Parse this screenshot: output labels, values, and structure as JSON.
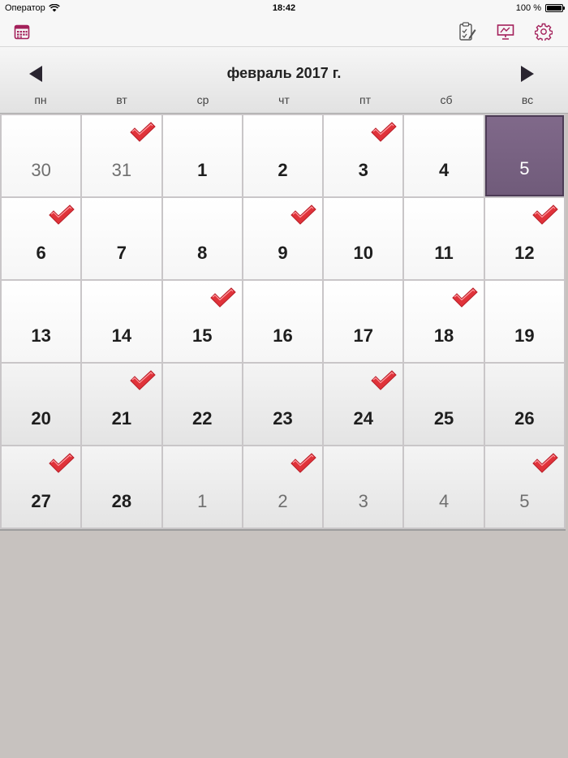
{
  "status_bar": {
    "carrier": "Оператор",
    "time": "18:42",
    "battery": "100 %"
  },
  "header": {
    "month_title": "февраль 2017 г.",
    "prev_label": "◀",
    "next_label": "▶"
  },
  "weekdays": [
    "пн",
    "вт",
    "ср",
    "чт",
    "пт",
    "сб",
    "вс"
  ],
  "toolbar": {
    "left": {
      "icon": "calendar-icon"
    },
    "right": [
      {
        "icon": "clipboard-edit-icon"
      },
      {
        "icon": "presentation-icon"
      },
      {
        "icon": "gear-icon"
      }
    ]
  },
  "colors": {
    "accent": "#a3205a",
    "selected": "#76617f",
    "check": "#e0333a"
  },
  "days": [
    {
      "label": "30",
      "current_month": false,
      "checked": false
    },
    {
      "label": "31",
      "current_month": false,
      "checked": true
    },
    {
      "label": "1",
      "current_month": true,
      "checked": false
    },
    {
      "label": "2",
      "current_month": true,
      "checked": false
    },
    {
      "label": "3",
      "current_month": true,
      "checked": true
    },
    {
      "label": "4",
      "current_month": true,
      "checked": false
    },
    {
      "label": "5",
      "current_month": true,
      "checked": false,
      "selected": true
    },
    {
      "label": "6",
      "current_month": true,
      "checked": true
    },
    {
      "label": "7",
      "current_month": true,
      "checked": false
    },
    {
      "label": "8",
      "current_month": true,
      "checked": false
    },
    {
      "label": "9",
      "current_month": true,
      "checked": true
    },
    {
      "label": "10",
      "current_month": true,
      "checked": false
    },
    {
      "label": "11",
      "current_month": true,
      "checked": false
    },
    {
      "label": "12",
      "current_month": true,
      "checked": true
    },
    {
      "label": "13",
      "current_month": true,
      "checked": false
    },
    {
      "label": "14",
      "current_month": true,
      "checked": false
    },
    {
      "label": "15",
      "current_month": true,
      "checked": true
    },
    {
      "label": "16",
      "current_month": true,
      "checked": false
    },
    {
      "label": "17",
      "current_month": true,
      "checked": false
    },
    {
      "label": "18",
      "current_month": true,
      "checked": true
    },
    {
      "label": "19",
      "current_month": true,
      "checked": false
    },
    {
      "label": "20",
      "current_month": true,
      "checked": false
    },
    {
      "label": "21",
      "current_month": true,
      "checked": true
    },
    {
      "label": "22",
      "current_month": true,
      "checked": false
    },
    {
      "label": "23",
      "current_month": true,
      "checked": false
    },
    {
      "label": "24",
      "current_month": true,
      "checked": true
    },
    {
      "label": "25",
      "current_month": true,
      "checked": false
    },
    {
      "label": "26",
      "current_month": true,
      "checked": false
    },
    {
      "label": "27",
      "current_month": true,
      "checked": true
    },
    {
      "label": "28",
      "current_month": true,
      "checked": false
    },
    {
      "label": "1",
      "current_month": false,
      "checked": false
    },
    {
      "label": "2",
      "current_month": false,
      "checked": true
    },
    {
      "label": "3",
      "current_month": false,
      "checked": false
    },
    {
      "label": "4",
      "current_month": false,
      "checked": false
    },
    {
      "label": "5",
      "current_month": false,
      "checked": true
    }
  ]
}
